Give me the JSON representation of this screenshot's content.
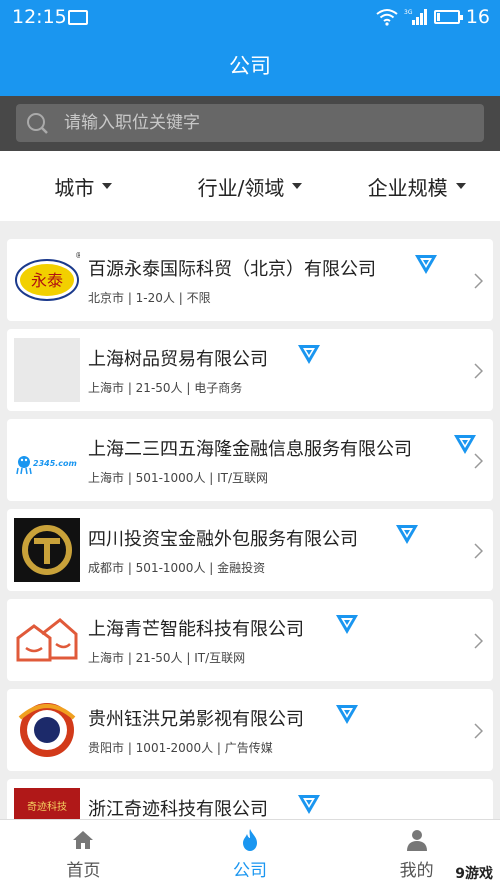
{
  "status": {
    "time": "12:15",
    "battery": "16",
    "network": "3G",
    "battery_level": 0.16
  },
  "header": {
    "title": "公司"
  },
  "search": {
    "placeholder": "请输入职位关键字"
  },
  "filters": [
    {
      "label": "城市"
    },
    {
      "label": "行业/领域"
    },
    {
      "label": "企业规模"
    }
  ],
  "companies": [
    {
      "name": "百源永泰国际科贸（北京）有限公司",
      "meta": "北京市 | 1-20人 | 不限",
      "logo_text": "永泰"
    },
    {
      "name": "上海树品贸易有限公司",
      "meta": "上海市 | 21-50人 | 电子商务"
    },
    {
      "name": "上海二三四五海隆金融信息服务有限公司",
      "meta": "上海市 | 501-1000人 | IT/互联网",
      "logo_text": "2345.com"
    },
    {
      "name": "四川投资宝金融外包服务有限公司",
      "meta": "成都市 | 501-1000人 | 金融投资",
      "logo_text": "T"
    },
    {
      "name": "上海青芒智能科技有限公司",
      "meta": "上海市 | 21-50人 | IT/互联网"
    },
    {
      "name": "贵州钰洪兄弟影视有限公司",
      "meta": "贵阳市 | 1001-2000人 | 广告传媒"
    },
    {
      "name": "浙江奇迹科技有限公司",
      "meta": "",
      "logo_text": "奇迹科技"
    }
  ],
  "nav": [
    {
      "label": "首页",
      "icon": "home-icon"
    },
    {
      "label": "公司",
      "icon": "flame-icon",
      "active": true
    },
    {
      "label": "我的",
      "icon": "person-icon"
    }
  ],
  "watermark": "9游戏",
  "colors": {
    "primary": "#1a96f0",
    "search_bg": "#484848",
    "vip": "#1a96f0"
  }
}
